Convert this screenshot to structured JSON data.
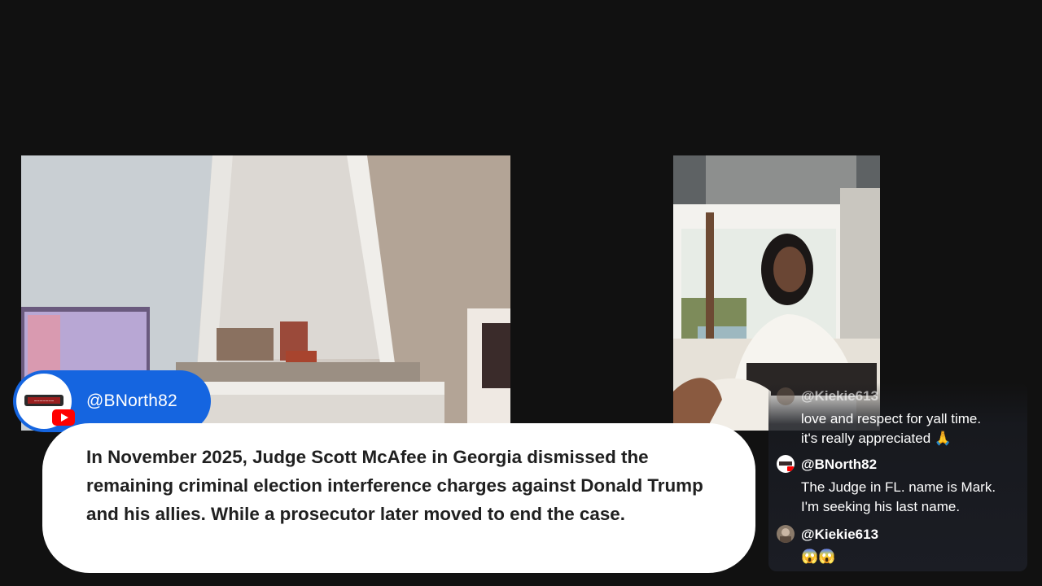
{
  "stream": {
    "host_badge": {
      "username": "@BNorth82",
      "avatar_icon": "bnorth82-logo-avatar",
      "platform_icon": "youtube-icon",
      "color": "#1565e0"
    }
  },
  "caption": {
    "text": "In November 2025, Judge Scott McAfee in Georgia dismissed the remaining criminal election interference charges against Donald Trump and his allies. While a prosecutor later moved to end the case."
  },
  "chat": {
    "messages": [
      {
        "username": "@Kiekie613",
        "lines": [
          "love and respect for yall time.",
          "it's really appreciated 🙏"
        ]
      },
      {
        "username": "@BNorth82",
        "lines": [
          "The Judge in FL. name is Mark.",
          "I'm seeking his last name."
        ]
      },
      {
        "username": "@Kiekie613",
        "lines": [
          "😱😱"
        ]
      }
    ]
  }
}
